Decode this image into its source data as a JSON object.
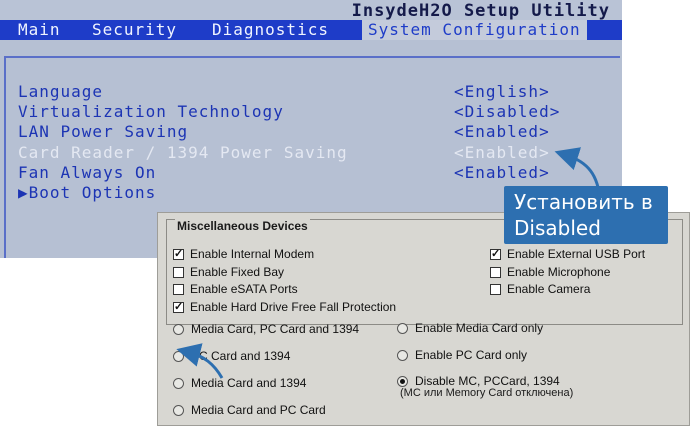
{
  "bios": {
    "title": "InsydeH2O Setup Utility",
    "tabs": [
      {
        "label": "Main"
      },
      {
        "label": "Security"
      },
      {
        "label": "Diagnostics"
      },
      {
        "label": "System Configuration"
      }
    ],
    "settings": [
      {
        "label": "Language",
        "value": "<English>"
      },
      {
        "label": "Virtualization Technology",
        "value": "<Disabled>"
      },
      {
        "label": "LAN Power Saving",
        "value": "<Enabled>"
      },
      {
        "label": "Card Reader / 1394 Power Saving",
        "value": "<Enabled>"
      },
      {
        "label": "Fan Always On",
        "value": "<Enabled>"
      },
      {
        "label": "▶Boot Options",
        "value": ""
      }
    ]
  },
  "callout": {
    "line1": "Установить в",
    "line2": "Disabled",
    "color": "#2d6fb0"
  },
  "misc": {
    "group_title": "Miscellaneous Devices",
    "checkboxes": [
      {
        "label": "Enable Internal Modem",
        "checked": true
      },
      {
        "label": "Enable External USB Port",
        "checked": true
      },
      {
        "label": "Enable Fixed Bay",
        "checked": false
      },
      {
        "label": "Enable Microphone",
        "checked": false
      },
      {
        "label": "Enable eSATA Ports",
        "checked": false
      },
      {
        "label": "Enable Camera",
        "checked": false
      },
      {
        "label": "Enable Hard Drive Free Fall Protection",
        "checked": true
      }
    ],
    "radios": [
      {
        "label": "Media Card, PC Card and 1394",
        "selected": false
      },
      {
        "label": "Enable Media Card only",
        "selected": false
      },
      {
        "label": "PC Card and 1394",
        "selected": false
      },
      {
        "label": "Enable PC Card only",
        "selected": false
      },
      {
        "label": "Media Card and 1394",
        "selected": false
      },
      {
        "label": "Disable MC, PCCard, 1394",
        "selected": true
      },
      {
        "label": "Media Card and PC Card",
        "selected": false
      }
    ],
    "note": "(MC или Memory Card отключена)"
  }
}
